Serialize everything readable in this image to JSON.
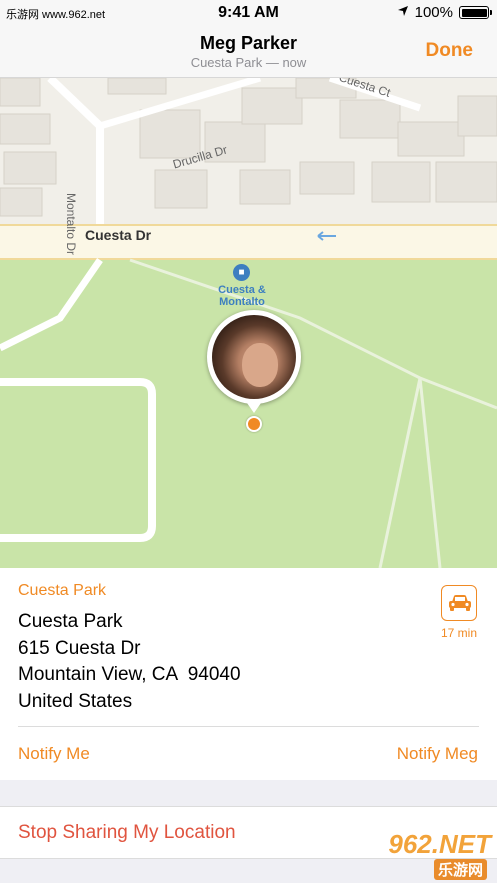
{
  "status_bar": {
    "carrier": "乐游网 www.962.net",
    "time": "9:41 AM",
    "battery": "100%",
    "location_icon": "location-arrow-icon"
  },
  "nav": {
    "title": "Meg Parker",
    "subtitle": "Cuesta Park — now",
    "done_label": "Done"
  },
  "map": {
    "streets": {
      "main": "Cuesta Dr",
      "drucilla": "Drucilla Dr",
      "montalto": "Montalto Dr",
      "ct": "Cuesta Ct"
    },
    "poi_name": "Cuesta & Montalto",
    "colors": {
      "park": "#c9e4a8",
      "road": "#fbf7e6",
      "building": "#e8e5df",
      "accent": "#f08a24"
    }
  },
  "card": {
    "place_name": "Cuesta Park",
    "address_line1": "Cuesta Park",
    "address_line2": "615 Cuesta Dr",
    "address_line3": "Mountain View, CA  94040",
    "address_line4": "United States",
    "drive_time": "17 min",
    "drive_icon": "car-icon",
    "notify_me": "Notify Me",
    "notify_meg": "Notify Meg"
  },
  "stop_sharing": "Stop Sharing My Location",
  "watermark": {
    "main": "962.NET",
    "sub": "乐游网"
  }
}
